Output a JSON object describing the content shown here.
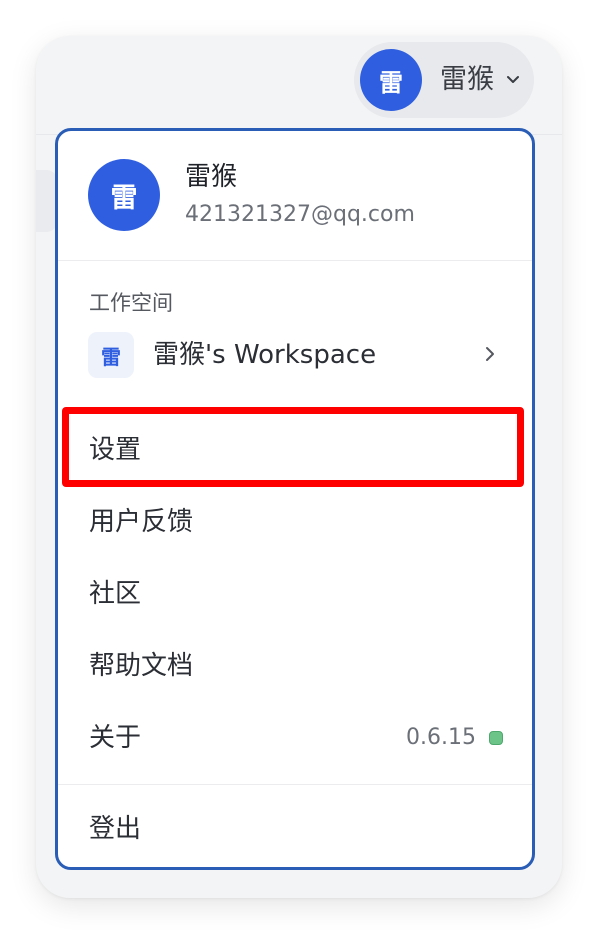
{
  "header": {
    "avatar_char": "雷",
    "user_name": "雷猴",
    "chevron_icon": "chevron-down-icon"
  },
  "menu": {
    "profile": {
      "avatar_char": "雷",
      "name": "雷猴",
      "email": "421321327@qq.com"
    },
    "workspace_section": {
      "label": "工作空间",
      "workspace_icon_char": "雷",
      "workspace_name": "雷猴's Workspace",
      "chevron_icon": "chevron-right-icon"
    },
    "items": {
      "settings": "设置",
      "feedback": "用户反馈",
      "community": "社区",
      "docs": "帮助文档",
      "about": "关于",
      "logout": "登出"
    },
    "version": "0.6.15",
    "status_color": "#6cc489",
    "accent_color": "#2f5fe0",
    "highlight_color": "#ff0000"
  }
}
